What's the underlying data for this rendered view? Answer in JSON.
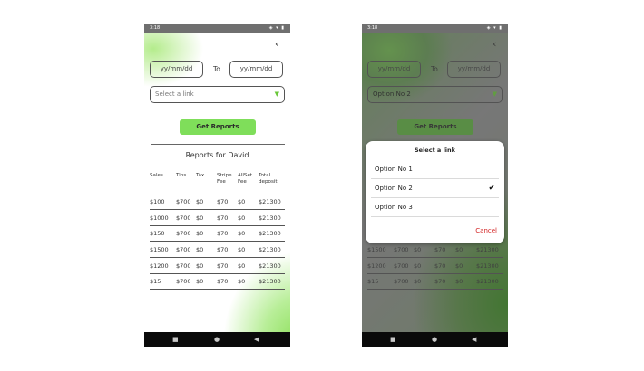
{
  "status": {
    "time": "3:18",
    "icons": "◈ ▾ ▮"
  },
  "header": {
    "back_icon": "‹"
  },
  "filters": {
    "from_placeholder": "yy/mm/dd",
    "to_label": "To",
    "to_placeholder": "yy/mm/dd",
    "link_placeholder": "Select a link",
    "link_selected": "Option No 2",
    "arrow": "▼"
  },
  "get_reports_label": "Get Reports",
  "report_title": "Reports for David",
  "table": {
    "headers": [
      {
        "l1": "Sales",
        "l2": ""
      },
      {
        "l1": "Tips",
        "l2": ""
      },
      {
        "l1": "Tax",
        "l2": ""
      },
      {
        "l1": "Stripe",
        "l2": "Fee"
      },
      {
        "l1": "AllSet",
        "l2": "Fee"
      },
      {
        "l1": "Total",
        "l2": "deposit"
      }
    ],
    "rows": [
      [
        "$100",
        "$700",
        "$0",
        "$70",
        "$0",
        "$21300"
      ],
      [
        "$1000",
        "$700",
        "$0",
        "$70",
        "$0",
        "$21300"
      ],
      [
        "$150",
        "$700",
        "$0",
        "$70",
        "$0",
        "$21300"
      ],
      [
        "$1500",
        "$700",
        "$0",
        "$70",
        "$0",
        "$21300"
      ],
      [
        "$1200",
        "$700",
        "$0",
        "$70",
        "$0",
        "$21300"
      ],
      [
        "$15",
        "$700",
        "$0",
        "$70",
        "$0",
        "$21300"
      ]
    ]
  },
  "dialog": {
    "title": "Select a link",
    "options": [
      "Option No 1",
      "Option No 2",
      "Option No 3"
    ],
    "selected_index": 1,
    "check_icon": "✔",
    "cancel_label": "Cancel"
  },
  "navbar": {
    "recent_icon": "■",
    "home_icon": "●",
    "back_icon": "◀"
  },
  "colors": {
    "accent": "#7fde5a",
    "cancel": "#d21f1f",
    "navbar": "#0a0a0a"
  }
}
